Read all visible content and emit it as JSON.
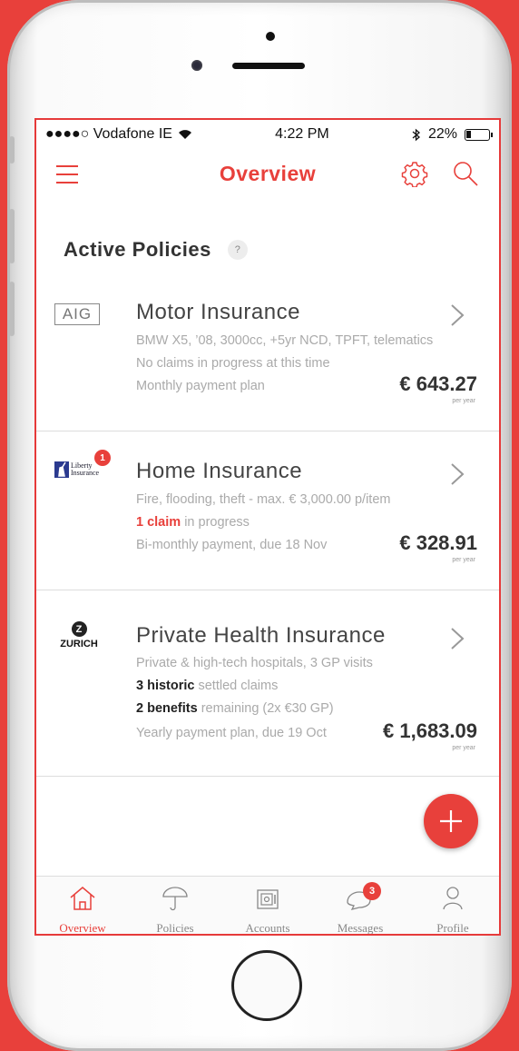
{
  "status_bar": {
    "carrier": "●●●●○ Vodafone IE",
    "time": "4:22 PM",
    "battery": "22%",
    "battery_level": 0.22
  },
  "header": {
    "title": "Overview"
  },
  "section": {
    "title": "Active Policies",
    "help": "?"
  },
  "policies": [
    {
      "logo": "AIG",
      "title": "Motor Insurance",
      "line1": "BMW X5, ’08, 3000cc, +5yr NCD, TPFT, telematics",
      "line2": "No claims in progress at this time",
      "payment": "Monthly payment plan",
      "price": "€ 643.27",
      "per": "per year"
    },
    {
      "logo_line1": "Liberty",
      "logo_line2": "Insurance",
      "logo_badge": "1",
      "title": "Home Insurance",
      "line1": "Fire, flooding, theft - max. € 3,000.00 p/item",
      "claim_strong": "1 claim",
      "claim_rest": " in progress",
      "payment": "Bi-monthly payment, due 18 Nov",
      "price": "€ 328.91",
      "per": "per year"
    },
    {
      "logo_letter": "Z",
      "logo": "ZURICH",
      "title": "Private Health Insurance",
      "line1": "Private & high-tech hospitals, 3 GP visits",
      "hist_strong": "3 historic",
      "hist_rest": " settled claims",
      "ben_strong": "2 benefits",
      "ben_rest": " remaining (2x €30 GP)",
      "payment": "Yearly payment plan, due 19 Oct",
      "price": "€ 1,683.09",
      "per": "per year"
    }
  ],
  "tabs": [
    {
      "label": "Overview",
      "icon": "home-icon",
      "active": true
    },
    {
      "label": "Policies",
      "icon": "umbrella-icon"
    },
    {
      "label": "Accounts",
      "icon": "safe-icon"
    },
    {
      "label": "Messages",
      "icon": "messages-icon",
      "badge": "3"
    },
    {
      "label": "Profile",
      "icon": "person-icon"
    }
  ],
  "colors": {
    "accent": "#e8403b",
    "text": "#444444",
    "muted": "#aaaaaa"
  }
}
